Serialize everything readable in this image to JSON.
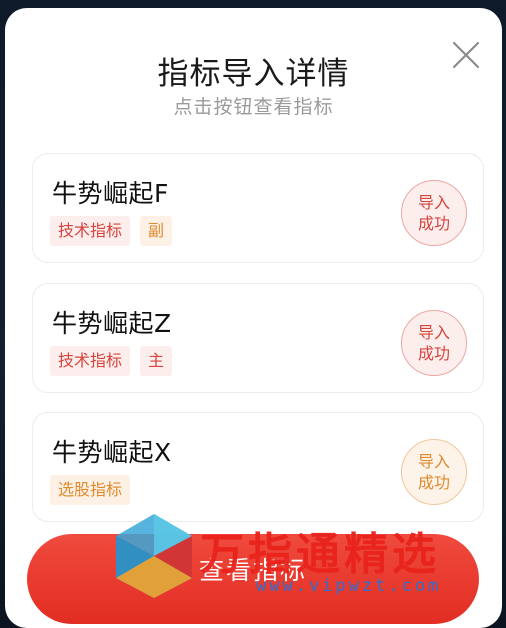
{
  "dialog": {
    "title": "指标导入详情",
    "subtitle": "点击按钮查看指标"
  },
  "indicators": [
    {
      "name": "牛势崛起F",
      "tags": [
        "技术指标",
        "副"
      ],
      "status_line1": "导入",
      "status_line2": "成功",
      "status_color": "#d4453c"
    },
    {
      "name": "牛势崛起Z",
      "tags": [
        "技术指标",
        "主"
      ],
      "status_line1": "导入",
      "status_line2": "成功",
      "status_color": "#d4453c"
    },
    {
      "name": "牛势崛起X",
      "tags": [
        "选股指标"
      ],
      "status_line1": "导入",
      "status_line2": "成功",
      "status_color": "#e08a2e"
    }
  ],
  "actions": {
    "view_label": "查看指标"
  },
  "watermark": {
    "text": "万指通精选",
    "url": "www.vipwzt.com"
  },
  "icons": [
    "close-icon"
  ],
  "colors": {
    "accent": "#e22d22",
    "tag_red": "#d4453c",
    "tag_orange": "#e08a2e"
  }
}
